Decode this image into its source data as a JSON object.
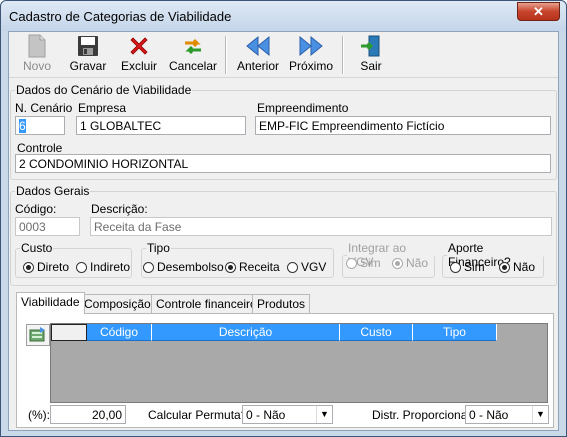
{
  "window": {
    "title": "Cadastro de Categorias de Viabilidade",
    "close_label": "✕"
  },
  "toolbar": {
    "novo": "Novo",
    "gravar": "Gravar",
    "excluir": "Excluir",
    "cancelar": "Cancelar",
    "anterior": "Anterior",
    "proximo": "Próximo",
    "sair": "Sair"
  },
  "cenario": {
    "legend": "Dados do Cenário de Viabilidade",
    "n_cenario_label": "N. Cenário",
    "n_cenario_value": "6",
    "empresa_label": "Empresa",
    "empresa_value": "1 GLOBALTEC",
    "empreendimento_label": "Empreendimento",
    "empreendimento_value": "EMP-FIC Empreendimento Fictício",
    "controle_label": "Controle",
    "controle_value": "2 CONDOMINIO HORIZONTAL"
  },
  "gerais": {
    "legend": "Dados Gerais",
    "codigo_label": "Código:",
    "codigo_value": "0003",
    "descricao_label": "Descrição:",
    "descricao_value": "Receita da Fase",
    "custo": {
      "legend": "Custo",
      "options": [
        "Direto",
        "Indireto"
      ],
      "selected": "Direto"
    },
    "tipo": {
      "legend": "Tipo",
      "options": [
        "Desembolso",
        "Receita",
        "VGV"
      ],
      "selected": "Receita"
    },
    "integrar": {
      "legend": "Integrar ao VGV",
      "options": [
        "Sim",
        "Não"
      ],
      "selected": "Não"
    },
    "aporte": {
      "legend": "Aporte Financeiro?",
      "options": [
        "Sim",
        "Não"
      ],
      "selected": "Não"
    }
  },
  "tabs": [
    "Viabilidade",
    "Composição",
    "Controle financeiro",
    "Produtos"
  ],
  "active_tab": "Viabilidade",
  "grid": {
    "columns": [
      "Código",
      "Descrição",
      "Custo",
      "Tipo"
    ],
    "rows": []
  },
  "footer": {
    "percent_label": "(%):",
    "percent_value": "20,00",
    "permuta_label": "Calcular Permuta?",
    "permuta_value": "0 - Não",
    "distr_label": "Distr. Proporcional:",
    "distr_value": "0 - Não"
  },
  "colors": {
    "header_blue": "#3399ff",
    "frame": "#c9d9ea",
    "close_red": "#c7442c"
  }
}
